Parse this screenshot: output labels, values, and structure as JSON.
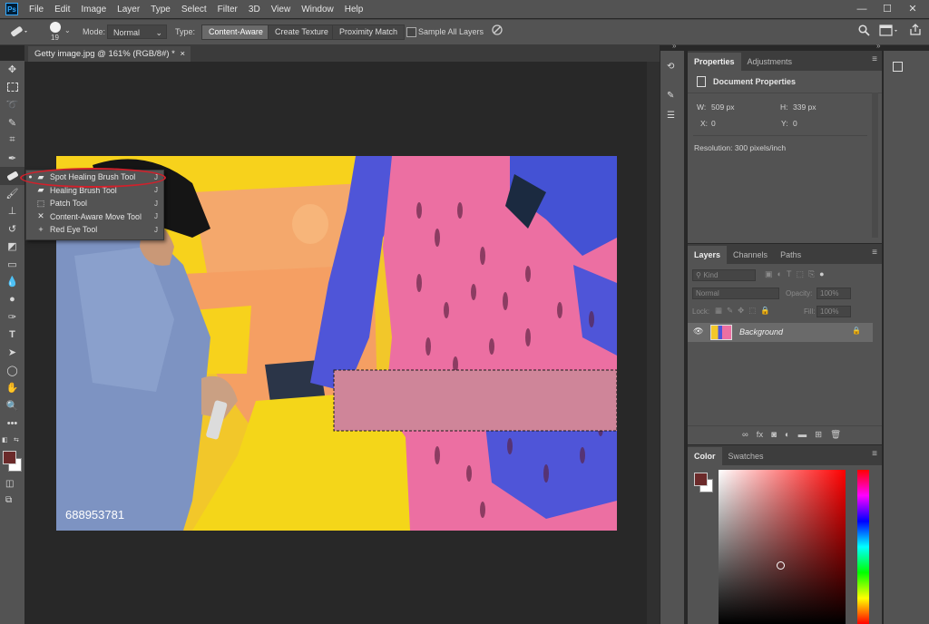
{
  "app": {
    "logo": "Ps"
  },
  "menubar": {
    "items": [
      "File",
      "Edit",
      "Image",
      "Layer",
      "Type",
      "Select",
      "Filter",
      "3D",
      "View",
      "Window",
      "Help"
    ],
    "window_controls": [
      "—",
      "☐",
      "✕"
    ]
  },
  "options": {
    "brush_size": "19",
    "mode_label": "Mode:",
    "mode_value": "Normal",
    "type_label": "Type:",
    "type_buttons": [
      "Content-Aware",
      "Create Texture",
      "Proximity Match"
    ],
    "sample_all_label": "Sample All Layers",
    "sample_all_checked": false
  },
  "document": {
    "tab_title": "Getty image.jpg @ 161% (RGB/8#) *",
    "tab_close": "×",
    "watermark_id": "688953781"
  },
  "tool_flyout": {
    "items": [
      {
        "label": "Spot Healing Brush Tool",
        "key": "J",
        "selected": true
      },
      {
        "label": "Healing Brush Tool",
        "key": "J",
        "selected": false
      },
      {
        "label": "Patch Tool",
        "key": "J",
        "selected": false
      },
      {
        "label": "Content-Aware Move Tool",
        "key": "J",
        "selected": false
      },
      {
        "label": "Red Eye Tool",
        "key": "J",
        "selected": false
      }
    ]
  },
  "properties_panel": {
    "tabs": [
      "Properties",
      "Adjustments"
    ],
    "heading": "Document Properties",
    "w_label": "W:",
    "w_value": "509 px",
    "h_label": "H:",
    "h_value": "339 px",
    "x_label": "X:",
    "x_value": "0",
    "y_label": "Y:",
    "y_value": "0",
    "resolution": "Resolution: 300 pixels/inch"
  },
  "layers_panel": {
    "tabs": [
      "Layers",
      "Channels",
      "Paths"
    ],
    "filter_placeholder": "Kind",
    "blend_mode": "Normal",
    "opacity_label": "Opacity:",
    "opacity_value": "100%",
    "lock_label": "Lock:",
    "fill_label": "Fill:",
    "fill_value": "100%",
    "layers": [
      {
        "name": "Background",
        "visible": true,
        "locked": true
      }
    ]
  },
  "color_panel": {
    "tabs": [
      "Color",
      "Swatches"
    ],
    "foreground": "#6b2a2a",
    "background": "#ffffff"
  },
  "colors": {
    "accent_highlight": "#d2202b",
    "panel_bg": "#535353",
    "canvas_bg": "#282828"
  }
}
